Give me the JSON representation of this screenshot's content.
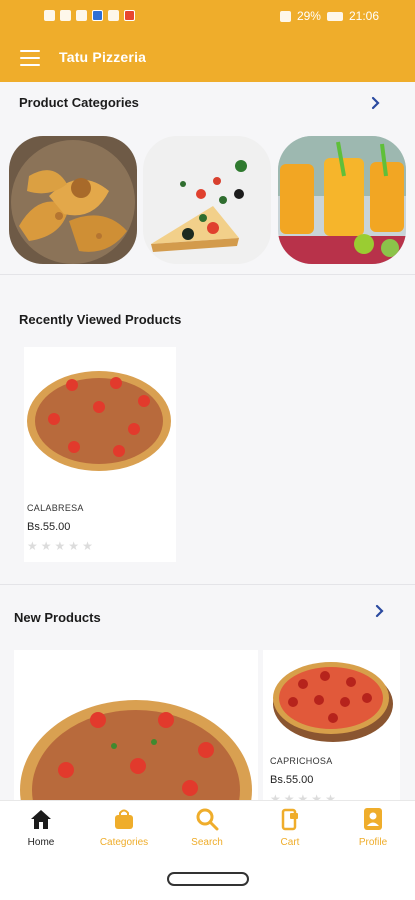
{
  "status_bar": {
    "battery": "29%",
    "time": "21:06"
  },
  "app_bar": {
    "title": "Tatu Pizzeria"
  },
  "categories_section": {
    "title": "Product Categories"
  },
  "recent_section": {
    "title": "Recently Viewed Products",
    "products": [
      {
        "name": "CALABRESA",
        "price": "Bs.55.00",
        "rating": 0
      }
    ]
  },
  "new_section": {
    "title": "New Products",
    "products": [
      {
        "name": "",
        "price": "",
        "rating": 0
      },
      {
        "name": "CAPRICHOSA",
        "price": "Bs.55.00",
        "rating": 0
      }
    ]
  },
  "bottom_nav": {
    "items": [
      {
        "label": "Home",
        "icon": "home-icon",
        "active": true
      },
      {
        "label": "Categories",
        "icon": "bag-icon",
        "active": false
      },
      {
        "label": "Search",
        "icon": "search-icon",
        "active": false
      },
      {
        "label": "Cart",
        "icon": "cart-icon",
        "active": false
      },
      {
        "label": "Profile",
        "icon": "profile-icon",
        "active": false
      }
    ]
  },
  "colors": {
    "brand": "#efad2b",
    "chevron": "#2b4aa0"
  }
}
